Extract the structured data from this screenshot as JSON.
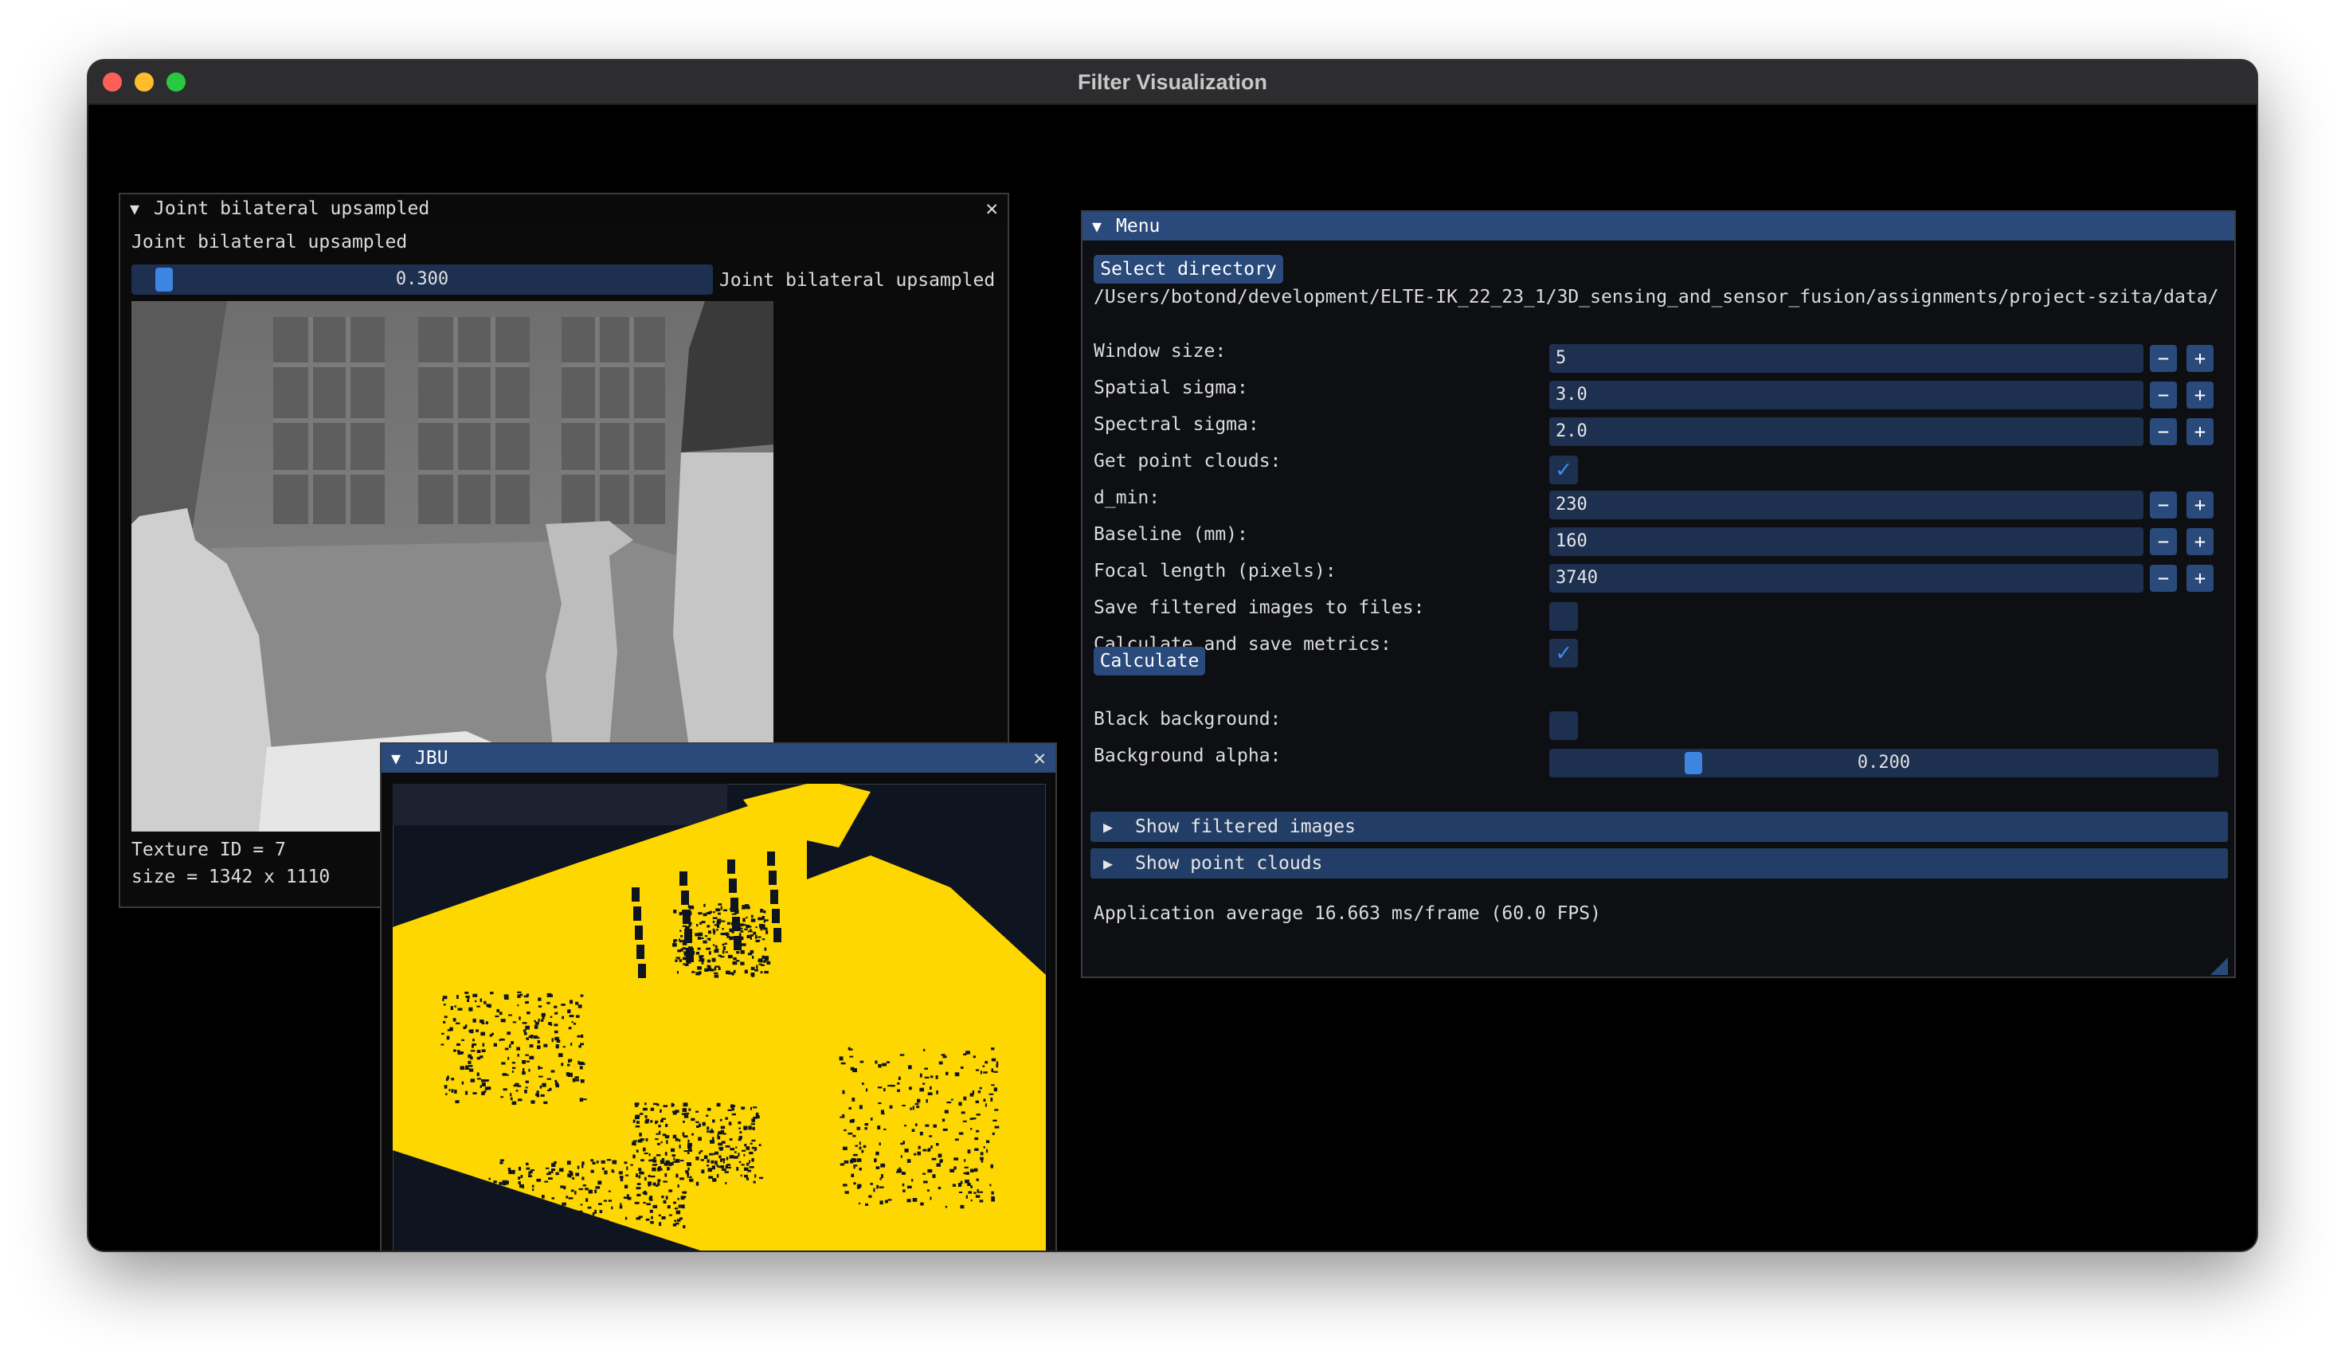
{
  "window": {
    "title": "Filter Visualization"
  },
  "joint_window": {
    "title": "Joint bilateral upsampled",
    "image_label": "Joint bilateral upsampled",
    "slider_value": "0.300",
    "slider_fraction": 0.05,
    "slider_label": "Joint bilateral upsampled",
    "texture_id": "Texture ID = 7",
    "size": "size = 1342 x 1110"
  },
  "jbu_window": {
    "title": "JBU",
    "point_color": "#ffd700"
  },
  "menu": {
    "title": "Menu",
    "select_directory": "Select directory",
    "path": "/Users/botond/development/ELTE-IK_22_23_1/3D_sensing_and_sensor_fusion/assignments/project-szita/data/",
    "rows": [
      {
        "label": "Window size:",
        "type": "int",
        "value": "5"
      },
      {
        "label": "Spatial sigma:",
        "type": "int",
        "value": "3.0"
      },
      {
        "label": "Spectral sigma:",
        "type": "int",
        "value": "2.0"
      },
      {
        "label": "Get point clouds:",
        "type": "check",
        "checked": true
      },
      {
        "label": "d_min:",
        "type": "int",
        "value": "230"
      },
      {
        "label": "Baseline (mm):",
        "type": "int",
        "value": "160"
      },
      {
        "label": "Focal length (pixels):",
        "type": "int",
        "value": "3740"
      },
      {
        "label": "Save filtered images to files:",
        "type": "check",
        "checked": false
      },
      {
        "label": "Calculate and save metrics:",
        "type": "check",
        "checked": true
      }
    ],
    "calculate": "Calculate",
    "black_background": "Black background:",
    "black_background_checked": false,
    "background_alpha": "Background alpha:",
    "background_alpha_value": "0.200",
    "background_alpha_fraction": 0.2,
    "show_filtered": "Show filtered images",
    "show_point_clouds": "Show point clouds",
    "fps": "Application average 16.663 ms/frame (60.0 FPS)",
    "minus": "−",
    "plus": "+"
  },
  "colors": {
    "accent": "#294a7a",
    "frame": "#1d3050",
    "grab": "#3d85e0"
  }
}
